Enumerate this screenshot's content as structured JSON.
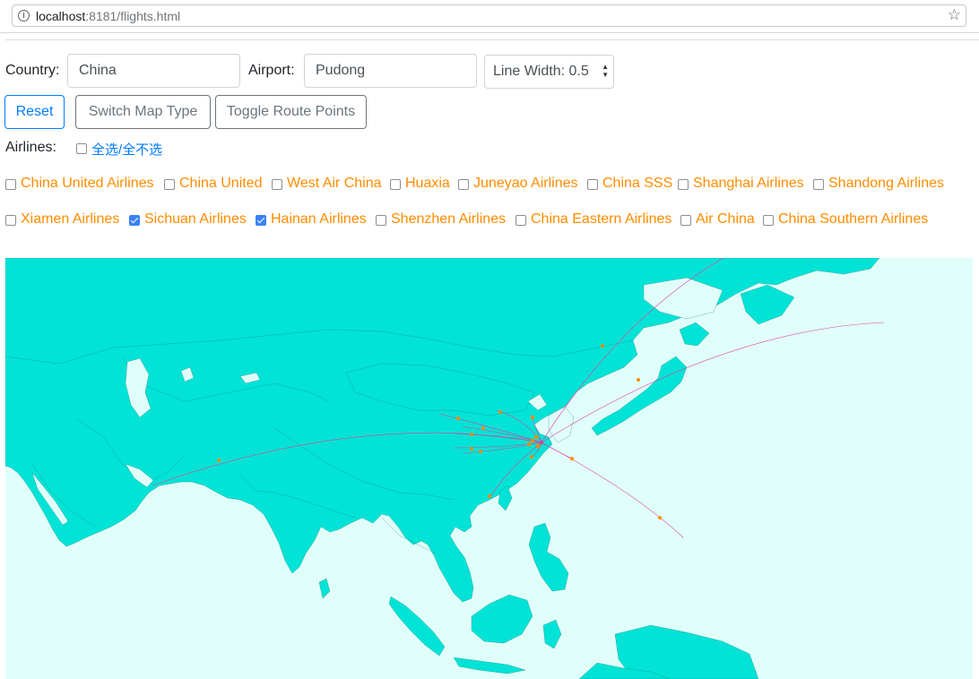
{
  "browser": {
    "url_host": "localhost",
    "url_rest": ":8181/flights.html",
    "info_icon": "info-icon",
    "star_icon": "star-icon"
  },
  "form": {
    "country_label": "Country:",
    "country_value": "China",
    "airport_label": "Airport:",
    "airport_value": "Pudong",
    "line_width_label": "Line Width: 0.5"
  },
  "buttons": {
    "reset": "Reset",
    "switch_map": "Switch Map Type",
    "toggle_points": "Toggle Route Points"
  },
  "airlines": {
    "label": "Airlines:",
    "toggle_all": "全选/全不选",
    "toggle_all_checked": false,
    "row1": [
      {
        "name": "China United Airlines",
        "checked": false
      },
      {
        "name": "China United",
        "checked": false
      },
      {
        "name": "West Air China",
        "checked": false
      },
      {
        "name": "Huaxia",
        "checked": false
      },
      {
        "name": "Juneyao Airlines",
        "checked": false
      },
      {
        "name": "China SSS",
        "checked": false
      },
      {
        "name": "Shanghai Airlines",
        "checked": false
      },
      {
        "name": "Shandong Airlines",
        "checked": false
      }
    ],
    "row2": [
      {
        "name": "Xiamen Airlines",
        "checked": false
      },
      {
        "name": "Sichuan Airlines",
        "checked": true
      },
      {
        "name": "Hainan Airlines",
        "checked": true
      },
      {
        "name": "Shenzhen Airlines",
        "checked": false
      },
      {
        "name": "China Eastern Airlines",
        "checked": false
      },
      {
        "name": "Air China",
        "checked": false
      },
      {
        "name": "China Southern Airlines",
        "checked": false
      }
    ]
  },
  "colors": {
    "label_orange": "#ff8c00",
    "link_blue": "#007bff",
    "land": "#00e3d6",
    "sea": "#e0fffb",
    "route_line": "#e0409a",
    "route_point": "#ff8c00"
  }
}
